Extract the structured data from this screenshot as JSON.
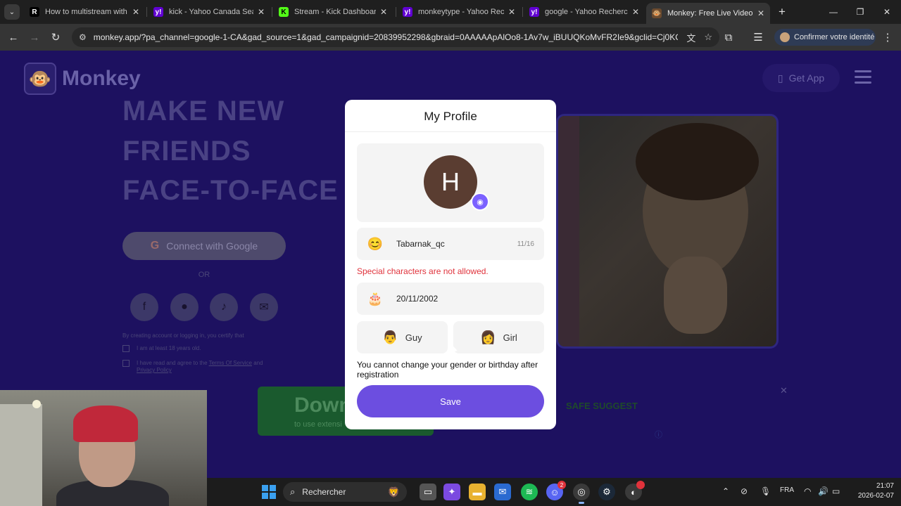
{
  "browser": {
    "tabs": [
      {
        "title": "How to multistream with C",
        "favicon": "R",
        "favicon_color": "#000000"
      },
      {
        "title": "kick - Yahoo Canada Searc",
        "favicon": "y!",
        "favicon_color": "#6001d2"
      },
      {
        "title": "Stream - Kick Dashboard",
        "favicon": "K",
        "favicon_color": "#53fc18"
      },
      {
        "title": "monkeytype - Yahoo Reche",
        "favicon": "y!",
        "favicon_color": "#6001d2"
      },
      {
        "title": "google - Yahoo Recherche",
        "favicon": "y!",
        "favicon_color": "#6001d2"
      },
      {
        "title": "Monkey: Free Live Video C",
        "favicon": "🐵",
        "favicon_color": "#3a3a3a"
      }
    ],
    "url": "monkey.app/?pa_channel=google-1-CA&gad_source=1&gad_campaignid=20839952298&gbraid=0AAAAApAlOo8-1Av7w_iBUUQKoMvFR2Ie9&gclid=Cj0KC...",
    "profile_chip": "Confirmer votre identité"
  },
  "site": {
    "logo_text": "Monkey",
    "get_app": "Get App",
    "hero": [
      "MAKE NEW",
      "FRIENDS",
      "FACE-TO-FACE"
    ],
    "google_button": "Connect with Google",
    "or_text": "OR",
    "consent_intro": "By creating account or logging in, you certify that",
    "consent_age": "I am at least 18 years old.",
    "consent_terms_prefix": "I have read and agree to the",
    "consent_terms_link": "Terms Of Service",
    "consent_and": "and",
    "consent_privacy_link": "Privacy Policy",
    "download_big": "Down",
    "download_small": "to use extensi",
    "safe_suggest": "SAFE SUGGEST"
  },
  "modal": {
    "title": "My Profile",
    "avatar_initial": "H",
    "username": "Tabarnak_qc",
    "username_count": "11/16",
    "error": "Special characters are not allowed.",
    "birthday": "20/11/2002",
    "gender_guy": "Guy",
    "gender_girl": "Girl",
    "notice": "You cannot change your gender or birthday after registration",
    "save": "Save"
  },
  "taskbar": {
    "search": "Rechercher",
    "language": "FRA",
    "time": "21:07",
    "date": "2026-02-07",
    "discord_badge": "2"
  },
  "colors": {
    "accent": "#6c4ee0",
    "error": "#e0323b",
    "page_bg": "#1d1160"
  }
}
